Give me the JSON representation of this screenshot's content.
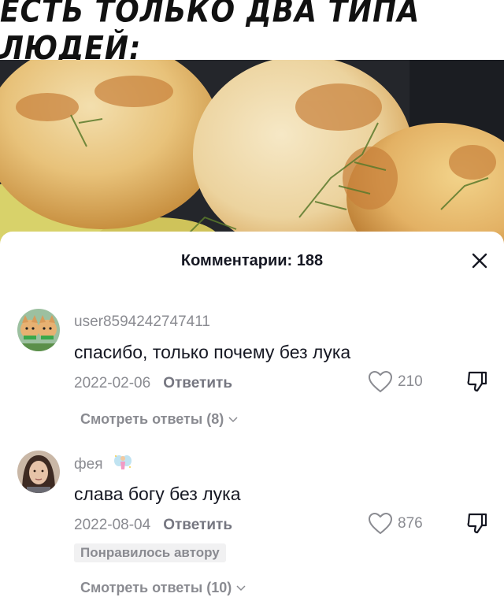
{
  "meme": {
    "title": "ЕСТЬ ТОЛЬКО ДВА ТИПА ЛЮДЕЙ:"
  },
  "comments_panel": {
    "title": "Комментарии: 188",
    "close_icon": "close-icon",
    "comments": [
      {
        "username": "user8594242747411",
        "text": "спасибо, только почему без лука",
        "date": "2022-02-06",
        "reply_label": "Ответить",
        "likes": "210",
        "view_replies": "Смотреть ответы (8)"
      },
      {
        "username": "фея",
        "username_icon": "fairy-emoji-icon",
        "text": "слава богу без лука",
        "date": "2022-08-04",
        "reply_label": "Ответить",
        "likes": "876",
        "badge": "Понравилось автору",
        "view_replies": "Смотреть ответы (10)"
      }
    ]
  },
  "colors": {
    "text_primary": "#161823",
    "text_secondary": "#8a8b91",
    "badge_bg": "#f1f1f2"
  }
}
